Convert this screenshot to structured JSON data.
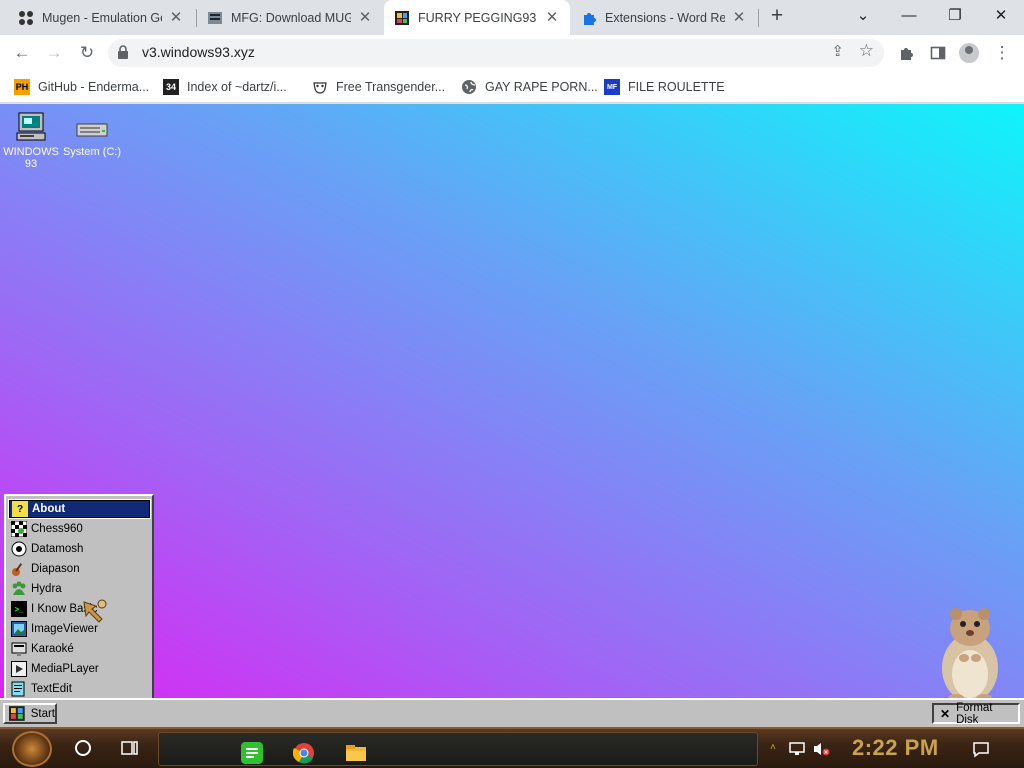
{
  "browser": {
    "tabs": [
      {
        "title": "Mugen - Emulation Ge",
        "icon": "mugen-favicon",
        "active": false
      },
      {
        "title": "MFG: Download MUGE",
        "icon": "mfg-favicon",
        "active": false
      },
      {
        "title": "FURRY PEGGING93",
        "icon": "windows93-favicon",
        "active": true
      },
      {
        "title": "Extensions - Word Re",
        "icon": "puzzle-icon",
        "active": false
      }
    ],
    "new_tab_label": "+",
    "url": "v3.windows93.xyz",
    "bookmarks": [
      {
        "label": "GitHub - Enderma...",
        "icon_text": "PH"
      },
      {
        "label": "Index of ~dartz/i...",
        "icon_text": "34"
      },
      {
        "label": "Free Transgender...",
        "icon_text": ""
      },
      {
        "label": "GAY RAPE PORN...",
        "icon_text": ""
      },
      {
        "label": "FILE ROULETTE",
        "icon_text": "MF"
      }
    ]
  },
  "desktop": {
    "icons": [
      {
        "label": "WINDOWS 93",
        "icon": "computer-icon"
      },
      {
        "label": "System (C:)",
        "icon": "drive-icon"
      }
    ]
  },
  "start_menu": {
    "items": [
      {
        "label": "About",
        "icon": "help-icon",
        "selected": true
      },
      {
        "label": "Chess960",
        "icon": "chess-icon"
      },
      {
        "label": "Datamosh",
        "icon": "datamosh-icon"
      },
      {
        "label": "Diapason",
        "icon": "guitar-icon"
      },
      {
        "label": "Hydra",
        "icon": "hydra-icon"
      },
      {
        "label": "I Know Basic",
        "icon": "terminal-icon"
      },
      {
        "label": "ImageViewer",
        "icon": "image-icon"
      },
      {
        "label": "Karaoké",
        "icon": "karaoke-icon"
      },
      {
        "label": "MediaPLayer",
        "icon": "media-icon"
      },
      {
        "label": "TextEdit",
        "icon": "textedit-icon"
      }
    ]
  },
  "w93_taskbar": {
    "start_label": "Start",
    "task_label": "Format Disk",
    "task_icon_text": "✕"
  },
  "os_taskbar": {
    "clock": "2:22 PM"
  },
  "colors": {
    "desktop_gradient_start": "#dd24f4",
    "desktop_gradient_end": "#0ef5fb",
    "menu_selected": "#102a78",
    "clock": "#c9a24a"
  }
}
